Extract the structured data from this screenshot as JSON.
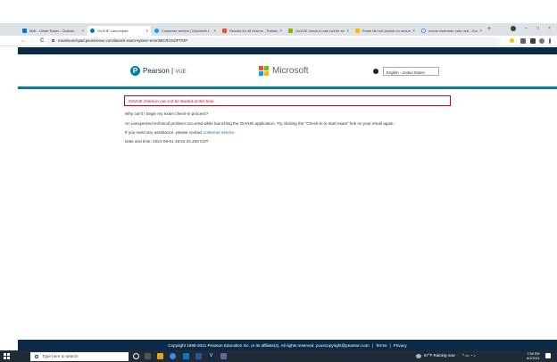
{
  "browser": {
    "tabs": [
      {
        "title": "Mail - Umair Rasel - Outlook",
        "color": "#0078d4"
      },
      {
        "title": "OnVUE Launchpad",
        "color": "#007fa3"
      },
      {
        "title": "Customer service | Microsoft L",
        "color": "#00a4ef"
      },
      {
        "title": "Results for all forums - Training",
        "color": "#f25022"
      },
      {
        "title": "OnVUE check-in can not be star",
        "color": "#7fba00"
      },
      {
        "title": "Exam did not launch on onvue",
        "color": "#ffb900"
      },
      {
        "title": "onvue customer care usa - Goo",
        "color": "#4285f4"
      }
    ],
    "tab_close": "×",
    "new_tab": "+",
    "window_controls": {
      "minimize": "–",
      "maximize": "□",
      "close": "×"
    },
    "nav": {
      "back": "←",
      "forward": "→",
      "reload": "C"
    },
    "url": "examlaunchpad.pearsonvue.com/launch-exam-system-error/MICROSOFT/OP"
  },
  "header": {
    "pearson_logo": "Pearson",
    "pearson_logo_suffix": "VUE",
    "microsoft_logo": "Microsoft",
    "language": "English - United States",
    "colors": {
      "band": "#0b2a4a",
      "accent": "#007fa3"
    }
  },
  "content": {
    "alert": "OnVUE check-in can not be started at this time.",
    "question": "Why can't I begin my exam check-in process?",
    "explanation": "An unexpected technical problem occurred while launching the OnVUE application. Try clicking the \"Check-in to start exam\" link on your email again.",
    "assistance_prefix": "If you need any assistance, please contact",
    "assistance_link": "customer service",
    "assistance_suffix": ".",
    "datetime": "Date and time: 2021-08-01 18:54:44.200 CDT"
  },
  "footer": {
    "copyright": "Copyright 1996-2021 Pearson Education Inc. or its affiliate(s). All rights reserved. pvuecopyright@pearson.com",
    "terms": "Terms",
    "privacy": "Privacy"
  },
  "taskbar": {
    "search_placeholder": "Type here to search",
    "weather": "67°F  Raining now",
    "time": "7:56 PM",
    "date": "8/1/2021"
  }
}
